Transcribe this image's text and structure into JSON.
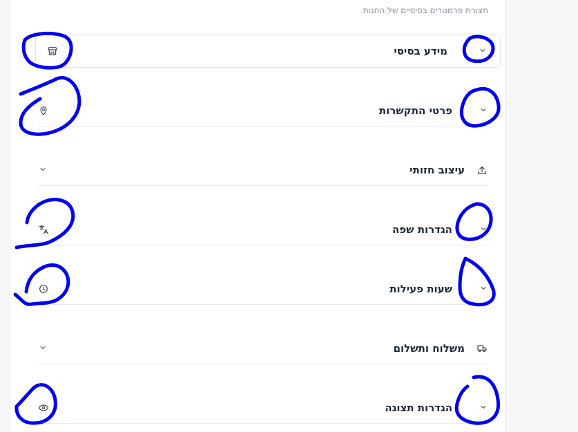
{
  "subtitle": "תצורת פרמטרים בסיסיים של החנות",
  "sections": [
    {
      "title": "מידע בסיסי",
      "icon": "store-icon"
    },
    {
      "title": "פרטי התקשרות",
      "icon": "map-pin-icon"
    },
    {
      "title": "עיצוב חזותי",
      "icon": "upload-icon"
    },
    {
      "title": "הגדרות שפה",
      "icon": "translate-icon"
    },
    {
      "title": "שעות פעילות",
      "icon": "clock-icon"
    },
    {
      "title": "משלוח ותשלום",
      "icon": "truck-icon"
    },
    {
      "title": "הגדרות תצוגה",
      "icon": "eye-icon"
    }
  ],
  "colors": {
    "annotation": "#0000ee",
    "border": "#e7ebf0",
    "text": "#1f2937"
  }
}
